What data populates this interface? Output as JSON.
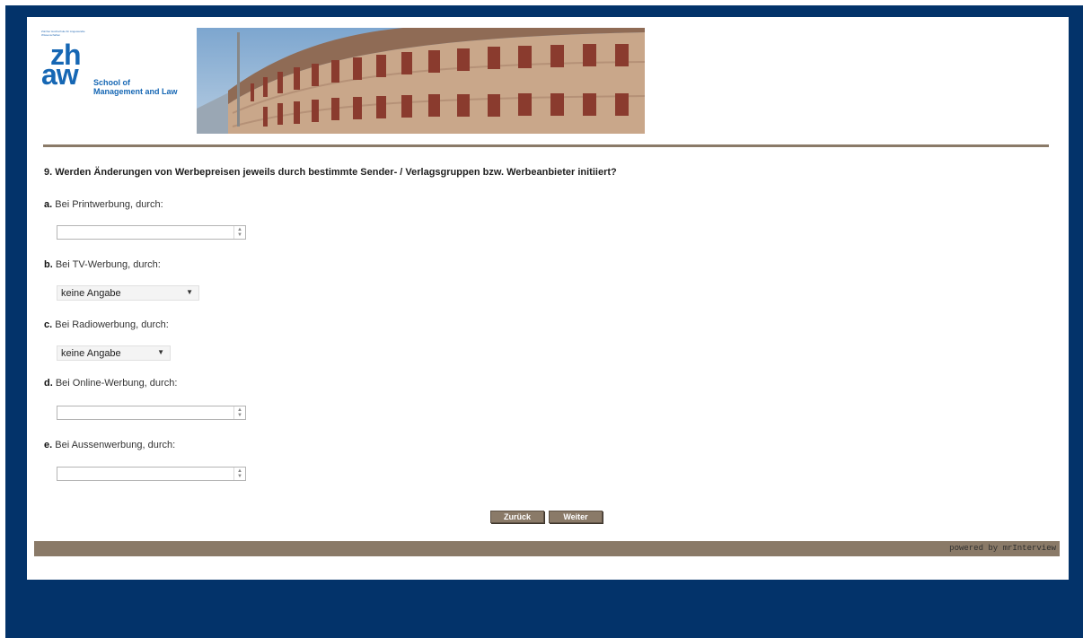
{
  "logo": {
    "tiny_text": "Zürcher Hochschule für Angewandte Wissenschaften",
    "zh": "zh",
    "aw": "aw",
    "school_line1": "School of",
    "school_line2": "Management and Law"
  },
  "question": "9. Werden Änderungen von Werbepreisen jeweils durch bestimmte Sender- / Verlagsgruppen bzw. Werbeanbieter initiiert?",
  "items": [
    {
      "letter": "a.",
      "label": " Bei Printwerbung, durch:",
      "type": "spin",
      "value": ""
    },
    {
      "letter": "b.",
      "label": " Bei TV-Werbung, durch:",
      "type": "select",
      "value": "keine Angabe"
    },
    {
      "letter": "c.",
      "label": " Bei Radiowerbung, durch:",
      "type": "select",
      "value": "keine Angabe"
    },
    {
      "letter": "d.",
      "label": " Bei Online-Werbung, durch:",
      "type": "spin",
      "value": ""
    },
    {
      "letter": "e.",
      "label": " Bei Aussenwerbung, durch:",
      "type": "spin",
      "value": ""
    }
  ],
  "buttons": {
    "back": "Zurück",
    "next": "Weiter"
  },
  "footer": "powered by mrInterview",
  "colors": {
    "frame": "#03336a",
    "accent": "#8a7a68",
    "brand": "#1667b4"
  }
}
